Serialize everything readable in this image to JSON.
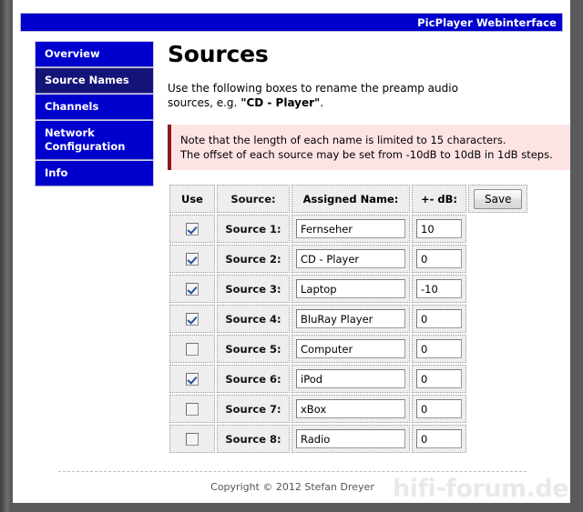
{
  "header": {
    "title": "PicPlayer Webinterface",
    "bar_color": "#0000cd"
  },
  "sidebar": {
    "items": [
      {
        "label": "Overview",
        "active": false
      },
      {
        "label": "Source Names",
        "active": true
      },
      {
        "label": "Channels",
        "active": false
      },
      {
        "label": "Network\nConfiguration",
        "active": false
      },
      {
        "label": "Info",
        "active": false
      }
    ],
    "active_color": "#141478",
    "item_color": "#0000cd"
  },
  "main": {
    "page_title": "Sources",
    "intro_prefix": "Use the following boxes to rename the preamp audio sources, e.g. ",
    "intro_emphasis": "\"CD - Player\"",
    "intro_suffix": ".",
    "note": {
      "line1": "Note that the length of each name is limited to 15 characters.",
      "line2": "The offset of each source may be set from -10dB to 10dB in 1dB steps.",
      "bg_color": "#fde3e3",
      "accent_color": "#8b1a1a"
    },
    "table": {
      "headers": {
        "use": "Use",
        "source": "Source:",
        "assigned_name": "Assigned Name:",
        "db": "+- dB:"
      },
      "save_label": "Save",
      "rows": [
        {
          "use_checked": true,
          "source": "Source 1:",
          "name": "Fernseher",
          "db": "10"
        },
        {
          "use_checked": true,
          "source": "Source 2:",
          "name": "CD - Player",
          "db": "0"
        },
        {
          "use_checked": true,
          "source": "Source 3:",
          "name": "Laptop",
          "db": "-10"
        },
        {
          "use_checked": true,
          "source": "Source 4:",
          "name": "BluRay Player",
          "db": "0"
        },
        {
          "use_checked": false,
          "source": "Source 5:",
          "name": "Computer",
          "db": "0"
        },
        {
          "use_checked": true,
          "source": "Source 6:",
          "name": "iPod",
          "db": "0"
        },
        {
          "use_checked": false,
          "source": "Source 7:",
          "name": "xBox",
          "db": "0"
        },
        {
          "use_checked": false,
          "source": "Source 8:",
          "name": "Radio",
          "db": "0"
        }
      ]
    }
  },
  "footer": {
    "copyright": "Copyright © 2012 Stefan Dreyer",
    "watermark": "hifi-forum.de"
  }
}
